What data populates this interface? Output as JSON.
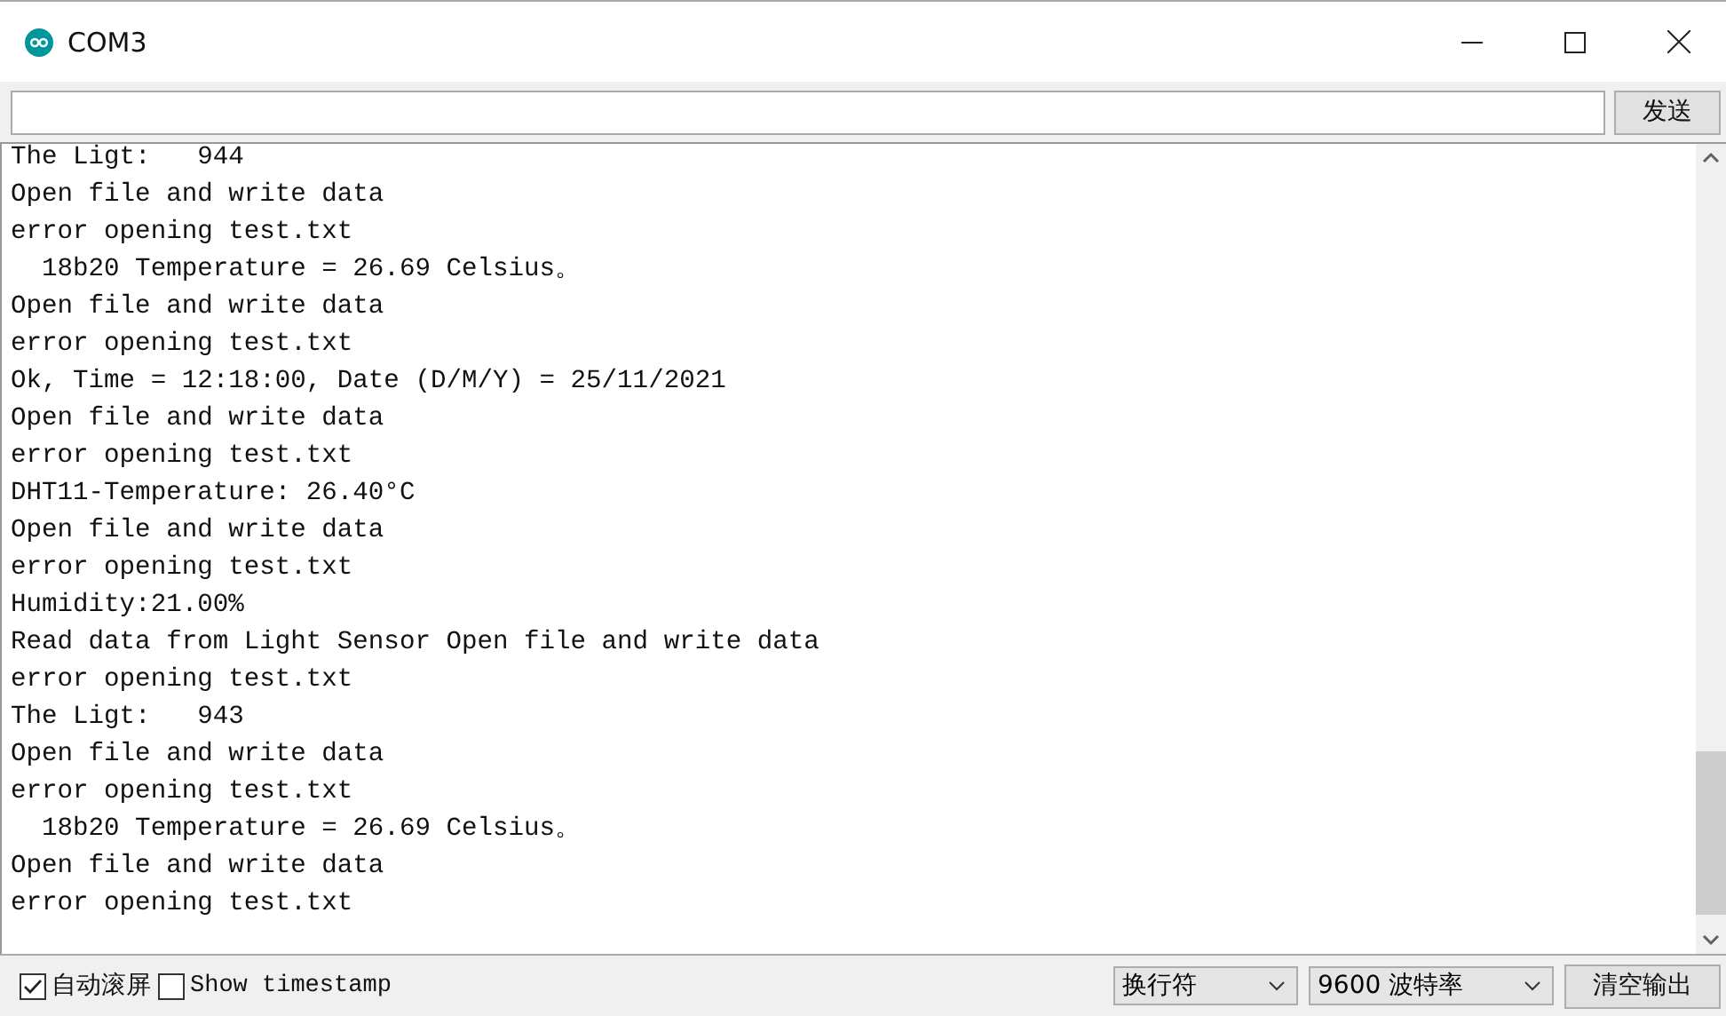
{
  "window": {
    "title": "COM3"
  },
  "send": {
    "button": "发送"
  },
  "output": {
    "lines": [
      "The Ligt:   944",
      "Open file and write data",
      "error opening test.txt",
      "  18b20 Temperature = 26.69 Celsius。",
      "Open file and write data",
      "error opening test.txt",
      "Ok, Time = 12:18:00, Date (D/M/Y) = 25/11/2021",
      "Open file and write data",
      "error opening test.txt",
      "DHT11-Temperature: 26.40°C",
      "Open file and write data",
      "error opening test.txt",
      "Humidity:21.00%",
      "Read data from Light Sensor Open file and write data",
      "error opening test.txt",
      "The Ligt:   943",
      "Open file and write data",
      "error opening test.txt",
      "  18b20 Temperature = 26.69 Celsius。",
      "Open file and write data",
      "error opening test.txt"
    ]
  },
  "status_bar": {
    "options": [
      {
        "label": "自动滚屏",
        "checked": true
      },
      {
        "label": "Show timestamp",
        "checked": false
      }
    ],
    "line_ending": "换行符",
    "baud_rate": "9600 波特率",
    "clear_button": "清空输出"
  }
}
